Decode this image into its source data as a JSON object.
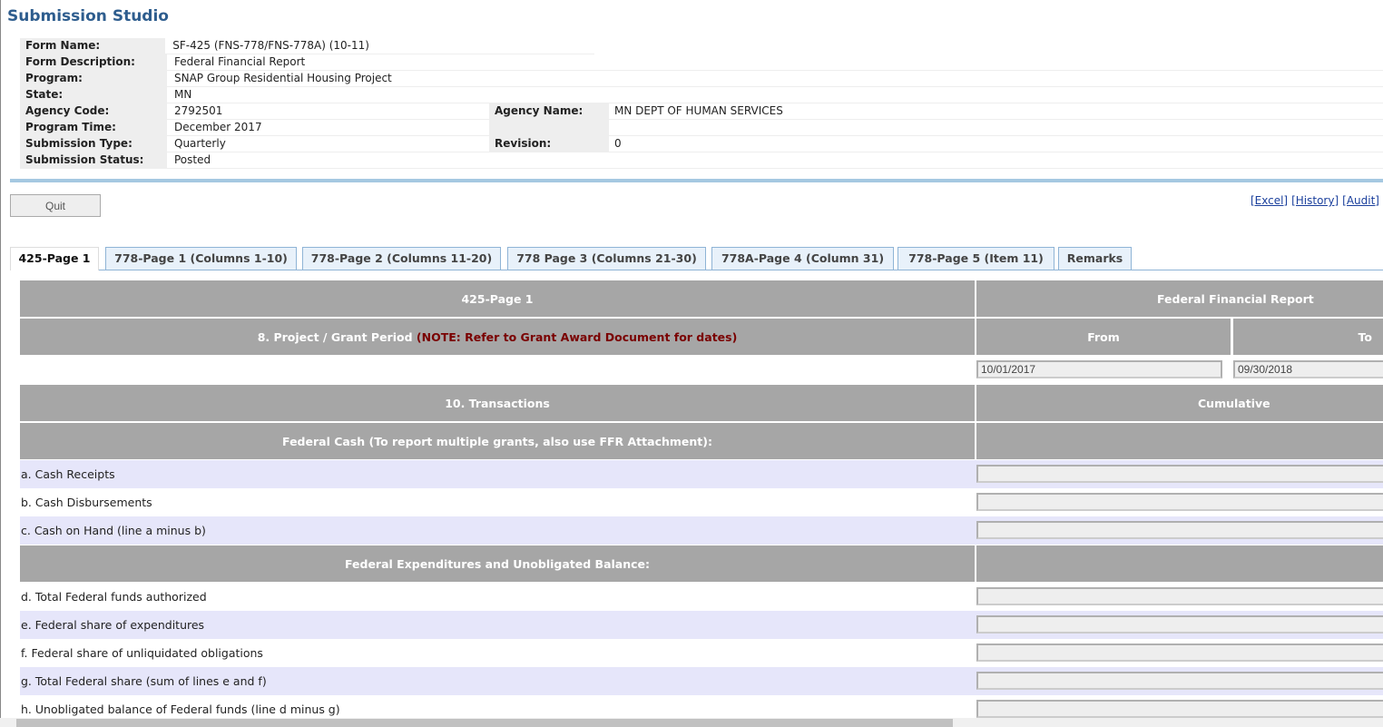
{
  "app_title": "Submission Studio",
  "info": {
    "form_name": {
      "label": "Form Name:",
      "value": "SF-425 (FNS-778/FNS-778A) (10-11)"
    },
    "form_description": {
      "label": "Form Description:",
      "value": "Federal Financial Report"
    },
    "program": {
      "label": "Program:",
      "value": "SNAP Group Residential Housing Project"
    },
    "state": {
      "label": "State:",
      "value": "MN"
    },
    "agency_code": {
      "label": "Agency Code:",
      "value": "2792501"
    },
    "agency_name": {
      "label": "Agency Name:",
      "value": "MN DEPT OF HUMAN SERVICES"
    },
    "program_time": {
      "label": "Program Time:",
      "value": "December 2017"
    },
    "submission_type": {
      "label": "Submission Type:",
      "value": "Quarterly"
    },
    "revision": {
      "label": "Revision:",
      "value": "0"
    },
    "submission_status": {
      "label": "Submission Status:",
      "value": "Posted"
    }
  },
  "toolbar": {
    "quit_label": "Quit",
    "links": [
      "[Excel]",
      "[History]",
      "[Audit]"
    ]
  },
  "tabs": [
    "425-Page 1",
    "778-Page 1 (Columns 1-10)",
    "778-Page 2 (Columns 11-20)",
    "778 Page 3 (Columns 21-30)",
    "778A-Page 4 (Column 31)",
    "778-Page 5 (Item 11)",
    "Remarks"
  ],
  "form": {
    "page_header": "425-Page 1",
    "report_header": "Federal Financial Report",
    "period_label": "8. Project / Grant Period",
    "period_note": "(NOTE: Refer to Grant Award Document for dates)",
    "from_label": "From",
    "to_label": "To",
    "from_value": "10/01/2017",
    "to_value": "09/30/2018",
    "transactions_label": "10. Transactions",
    "cumulative_label": "Cumulative",
    "federal_cash_label": "Federal Cash (To report multiple grants, also use FFR Attachment):",
    "expenditures_label": "Federal Expenditures and Unobligated Balance:",
    "lines": [
      "a. Cash Receipts",
      "b. Cash Disbursements",
      "c. Cash on Hand (line a minus b)",
      "d. Total Federal funds authorized",
      "e. Federal share of expenditures",
      "f. Federal share of unliquidated obligations",
      "g. Total Federal share (sum of lines e and f)",
      "h. Unobligated balance of Federal funds (line d minus g)"
    ]
  }
}
